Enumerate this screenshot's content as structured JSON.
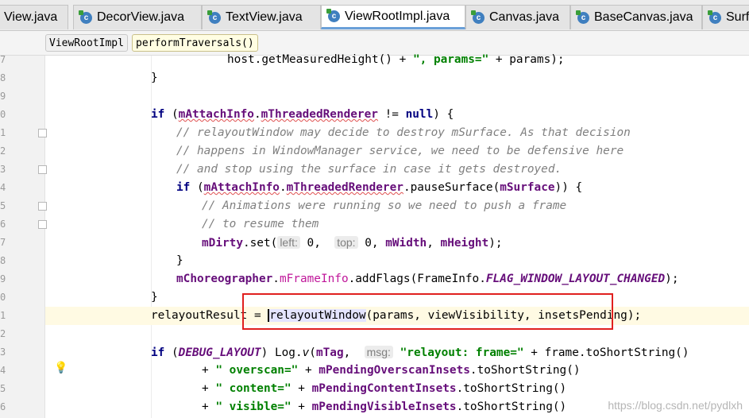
{
  "tabs": [
    {
      "label": "View.java",
      "active": false,
      "icon": false
    },
    {
      "label": "DecorView.java",
      "active": false,
      "icon": true
    },
    {
      "label": "TextView.java",
      "active": false,
      "icon": true
    },
    {
      "label": "ViewRootImpl.java",
      "active": true,
      "icon": true
    },
    {
      "label": "Canvas.java",
      "active": false,
      "icon": true
    },
    {
      "label": "BaseCanvas.java",
      "active": false,
      "icon": true
    },
    {
      "label": "Surf",
      "active": false,
      "icon": true
    }
  ],
  "tab_close_glyph": "×",
  "breadcrumb": [
    "ViewRootImpl",
    "performTraversals()"
  ],
  "gutter": {
    "line_numbers": [
      "7",
      "8",
      "9",
      "0",
      "1",
      "2",
      "3",
      "4",
      "5",
      "6",
      "7",
      "8",
      "9",
      "0",
      "1",
      "2",
      "3",
      "4",
      "5",
      "6"
    ],
    "intention_bulb_glyph": "💡"
  },
  "code": {
    "l1": {
      "a": "host.",
      "b": "getMeasuredHeight",
      "c": "() + ",
      "d": "\", params=\"",
      "e": " + params);"
    },
    "l2": "}",
    "l4": {
      "kw": "if",
      "open": " (",
      "f1": "mAttachInfo",
      "dot": ".",
      "f2": "mThreadedRenderer",
      "ne": " != ",
      "nul": "null",
      "close": ") {"
    },
    "l5": "// relayoutWindow may decide to destroy mSurface. As that decision",
    "l6": "// happens in WindowManager service, we need to be defensive here",
    "l7": "// and stop using the surface in case it gets destroyed.",
    "l8": {
      "kw": "if",
      "open": " (",
      "f1": "mAttachInfo",
      "dot": ".",
      "f2": "mThreadedRenderer",
      "m": ".pauseSurface(",
      "f3": "mSurface",
      "close": ")) {"
    },
    "l9": "// Animations were running so we need to push a frame",
    "l10": "// to resume them",
    "l11": {
      "f": "mDirty",
      "m": ".set(",
      "h1": "left:",
      "v1": " 0,  ",
      "h2": "top:",
      "v2": " 0, ",
      "f2": "mWidth",
      "c": ", ",
      "f3": "mHeight",
      "e": ");"
    },
    "l12": "}",
    "l13": {
      "f": "mChoreographer",
      "dot": ".",
      "f2": "mFrameInfo",
      "m": ".addFlags(FrameInfo.",
      "c": "FLAG_WINDOW_LAYOUT_CHANGED",
      "e": ");"
    },
    "l14": "}",
    "l15": {
      "a": "relayoutResult = ",
      "m": "relayoutWindow",
      "e": "(params, viewVisibility, insetsPending);"
    },
    "l17": {
      "kw": "if",
      "open": " (",
      "c": "DEBUG_LAYOUT",
      "m1": ") Log.",
      "m2": "v",
      "o": "(",
      "f": "mTag",
      "cm": ",  ",
      "h": "msg:",
      "s": " \"relayout: frame=\"",
      "e": " + frame.toShortString()"
    },
    "l18": {
      "p": "+ ",
      "s": "\" overscan=\"",
      "p2": " + ",
      "f": "mPendingOverscanInsets",
      "e": ".toShortString()"
    },
    "l19": {
      "p": "+ ",
      "s": "\" content=\"",
      "p2": " + ",
      "f": "mPendingContentInsets",
      "e": ".toShortString()"
    },
    "l20": {
      "p": "+ ",
      "s": "\" visible=\"",
      "p2": " + ",
      "f": "mPendingVisibleInsets",
      "e": ".toShortString()"
    }
  },
  "watermark": "https://blog.csdn.net/pydlxh"
}
